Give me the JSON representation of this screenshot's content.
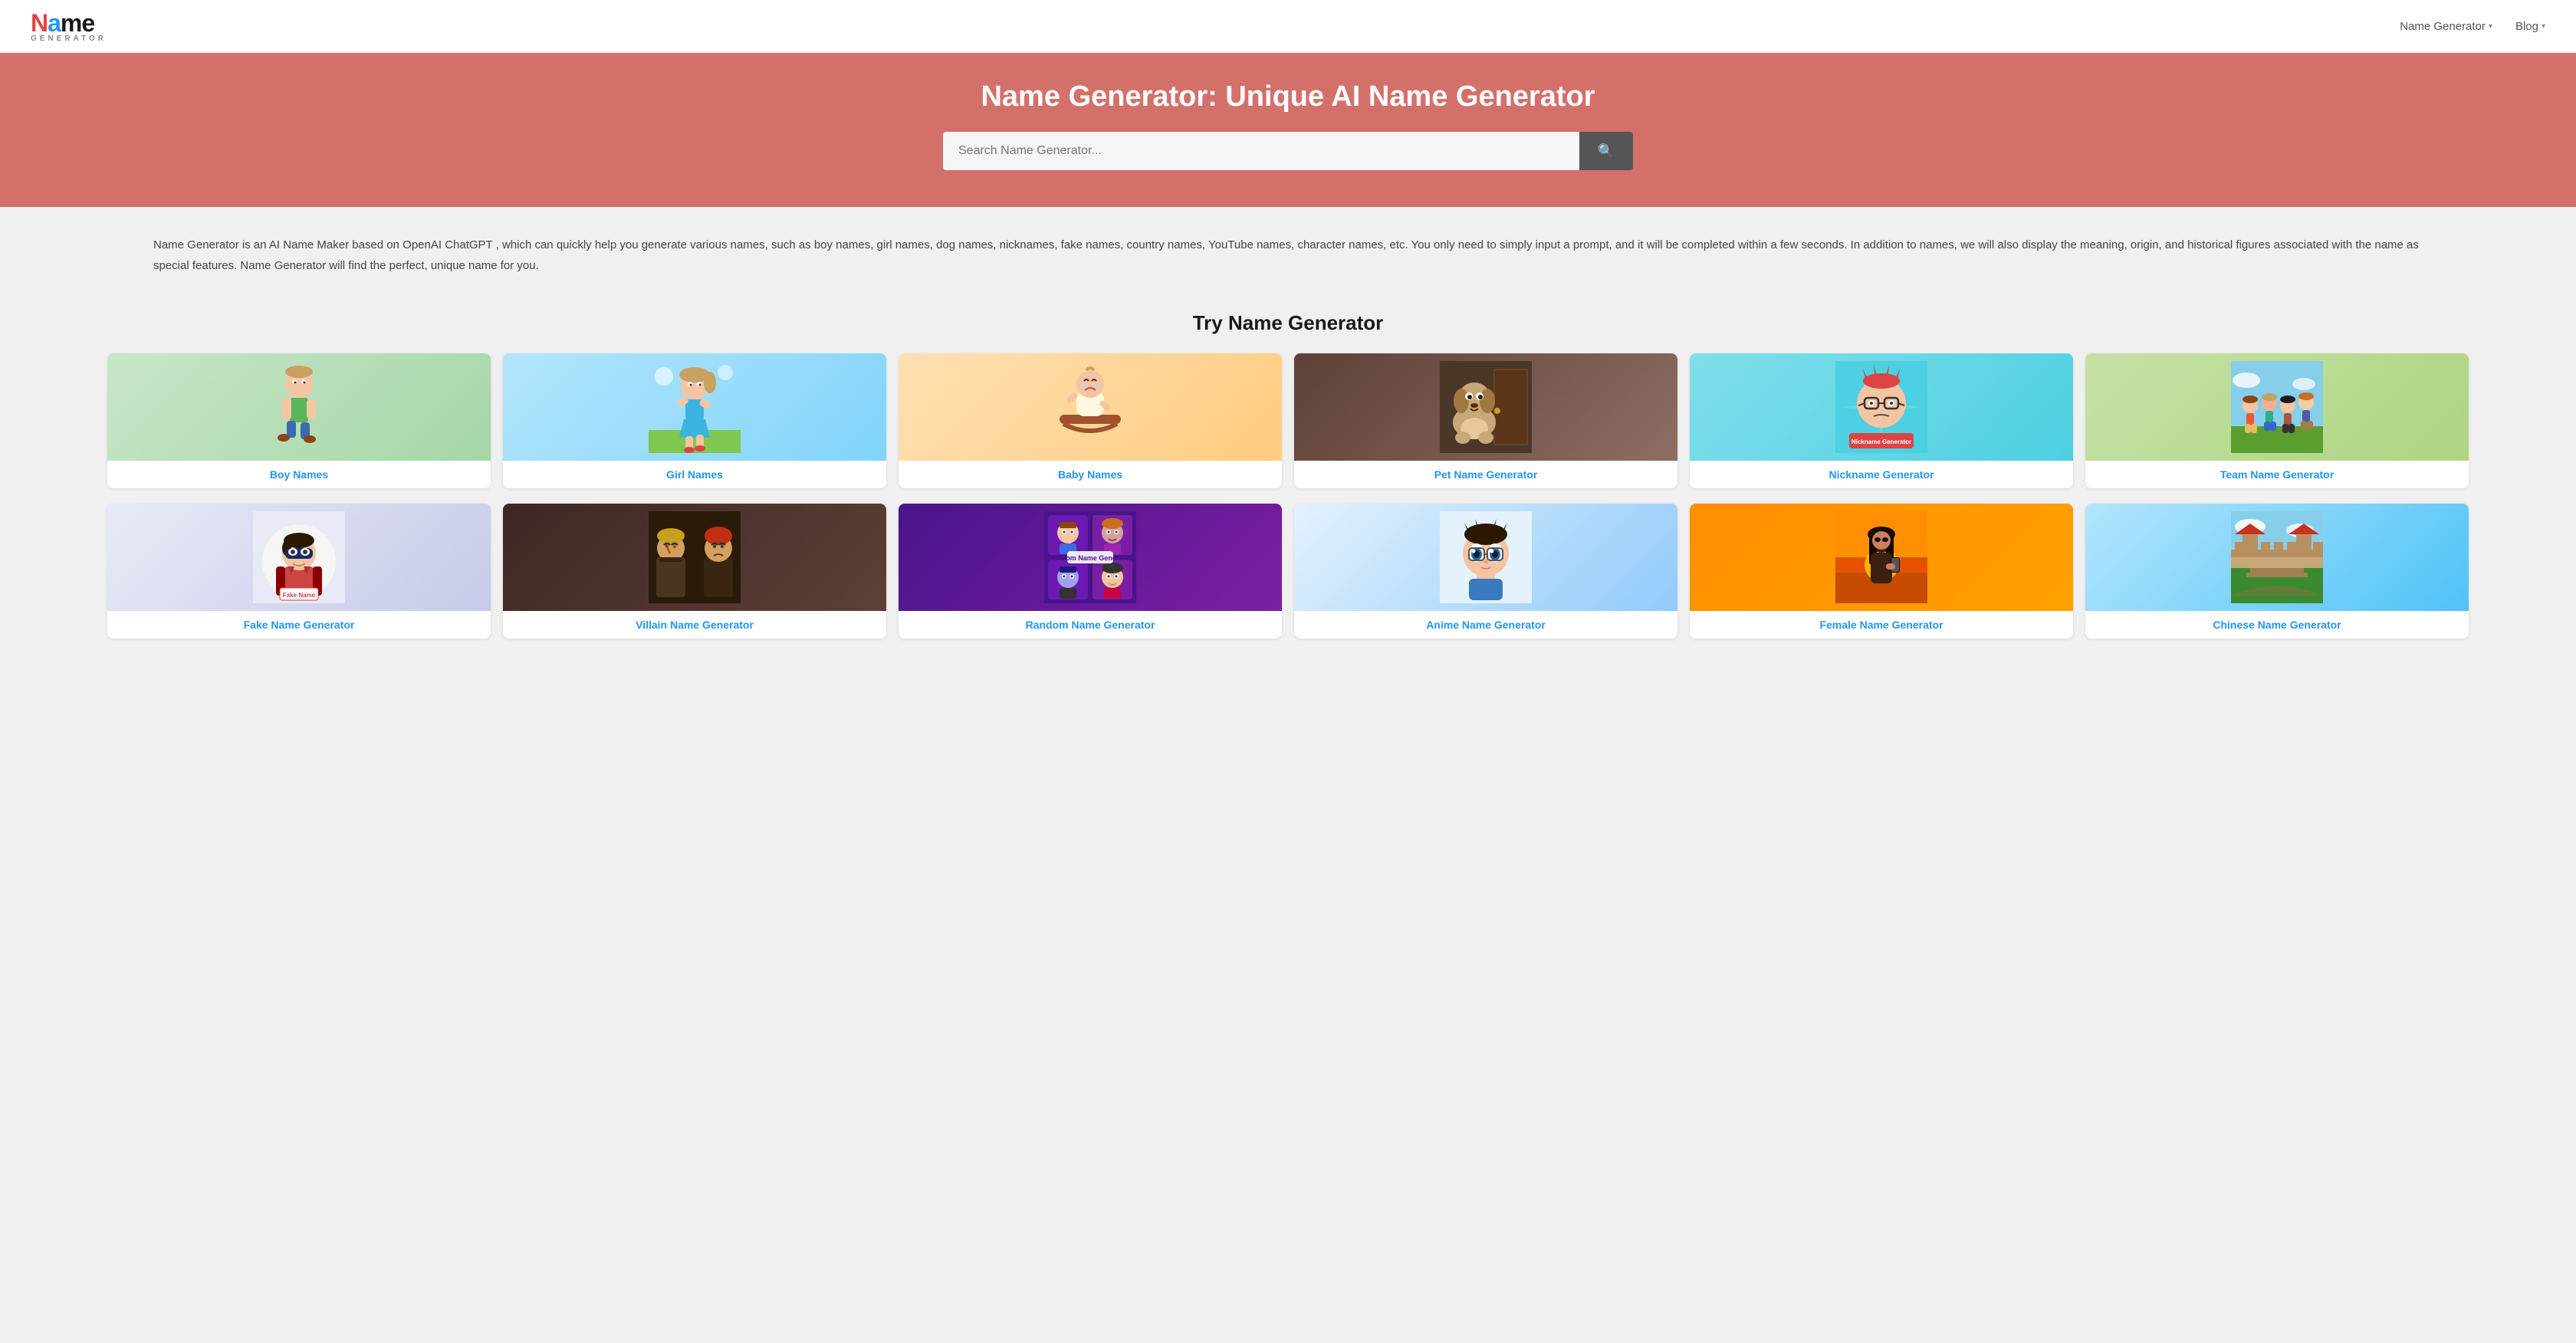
{
  "nav": {
    "logo_name": "Name",
    "logo_sub": "GENERATOR",
    "links": [
      {
        "label": "Name Generator",
        "has_dropdown": true
      },
      {
        "label": "Blog",
        "has_dropdown": true
      }
    ]
  },
  "hero": {
    "title": "Name Generator: Unique AI Name Generator",
    "search_placeholder": "Search Name Generator..."
  },
  "description": {
    "text": "Name Generator is an AI Name Maker based on OpenAI ChatGPT , which can quickly help you generate various names, such as boy names, girl names, dog names, nicknames, fake names, country names, YouTube names, character names, etc. You only need to simply input a prompt, and it will be completed within a few seconds. In addition to names, we will also display the meaning, origin, and historical figures associated with the name as special features. Name Generator will find the perfect, unique name for you."
  },
  "try_section": {
    "title": "Try Name Generator",
    "cards_row1": [
      {
        "label": "Boy Names",
        "emoji": "🧒",
        "color_class": "card-boy"
      },
      {
        "label": "Girl Names",
        "emoji": "👧",
        "color_class": "card-girl"
      },
      {
        "label": "Baby Names",
        "emoji": "👶",
        "color_class": "card-baby"
      },
      {
        "label": "Pet Name Generator",
        "emoji": "🐶",
        "color_class": "card-pet"
      },
      {
        "label": "Nickname Generator",
        "emoji": "😎",
        "color_class": "card-nick"
      },
      {
        "label": "Team Name Generator",
        "emoji": "👥",
        "color_class": "card-team"
      }
    ],
    "cards_row2": [
      {
        "label": "Fake Name Generator",
        "emoji": "🦸",
        "color_class": "card-fake"
      },
      {
        "label": "Villain Name Generator",
        "emoji": "😈",
        "color_class": "card-villain"
      },
      {
        "label": "Random Name Generator",
        "emoji": "🎲",
        "color_class": "card-random"
      },
      {
        "label": "Anime Name Generator",
        "emoji": "🤓",
        "color_class": "card-anime"
      },
      {
        "label": "Female Name Generator",
        "emoji": "👩",
        "color_class": "card-female"
      },
      {
        "label": "Chinese Name Generator",
        "emoji": "🏔️",
        "color_class": "card-chinese"
      }
    ]
  }
}
